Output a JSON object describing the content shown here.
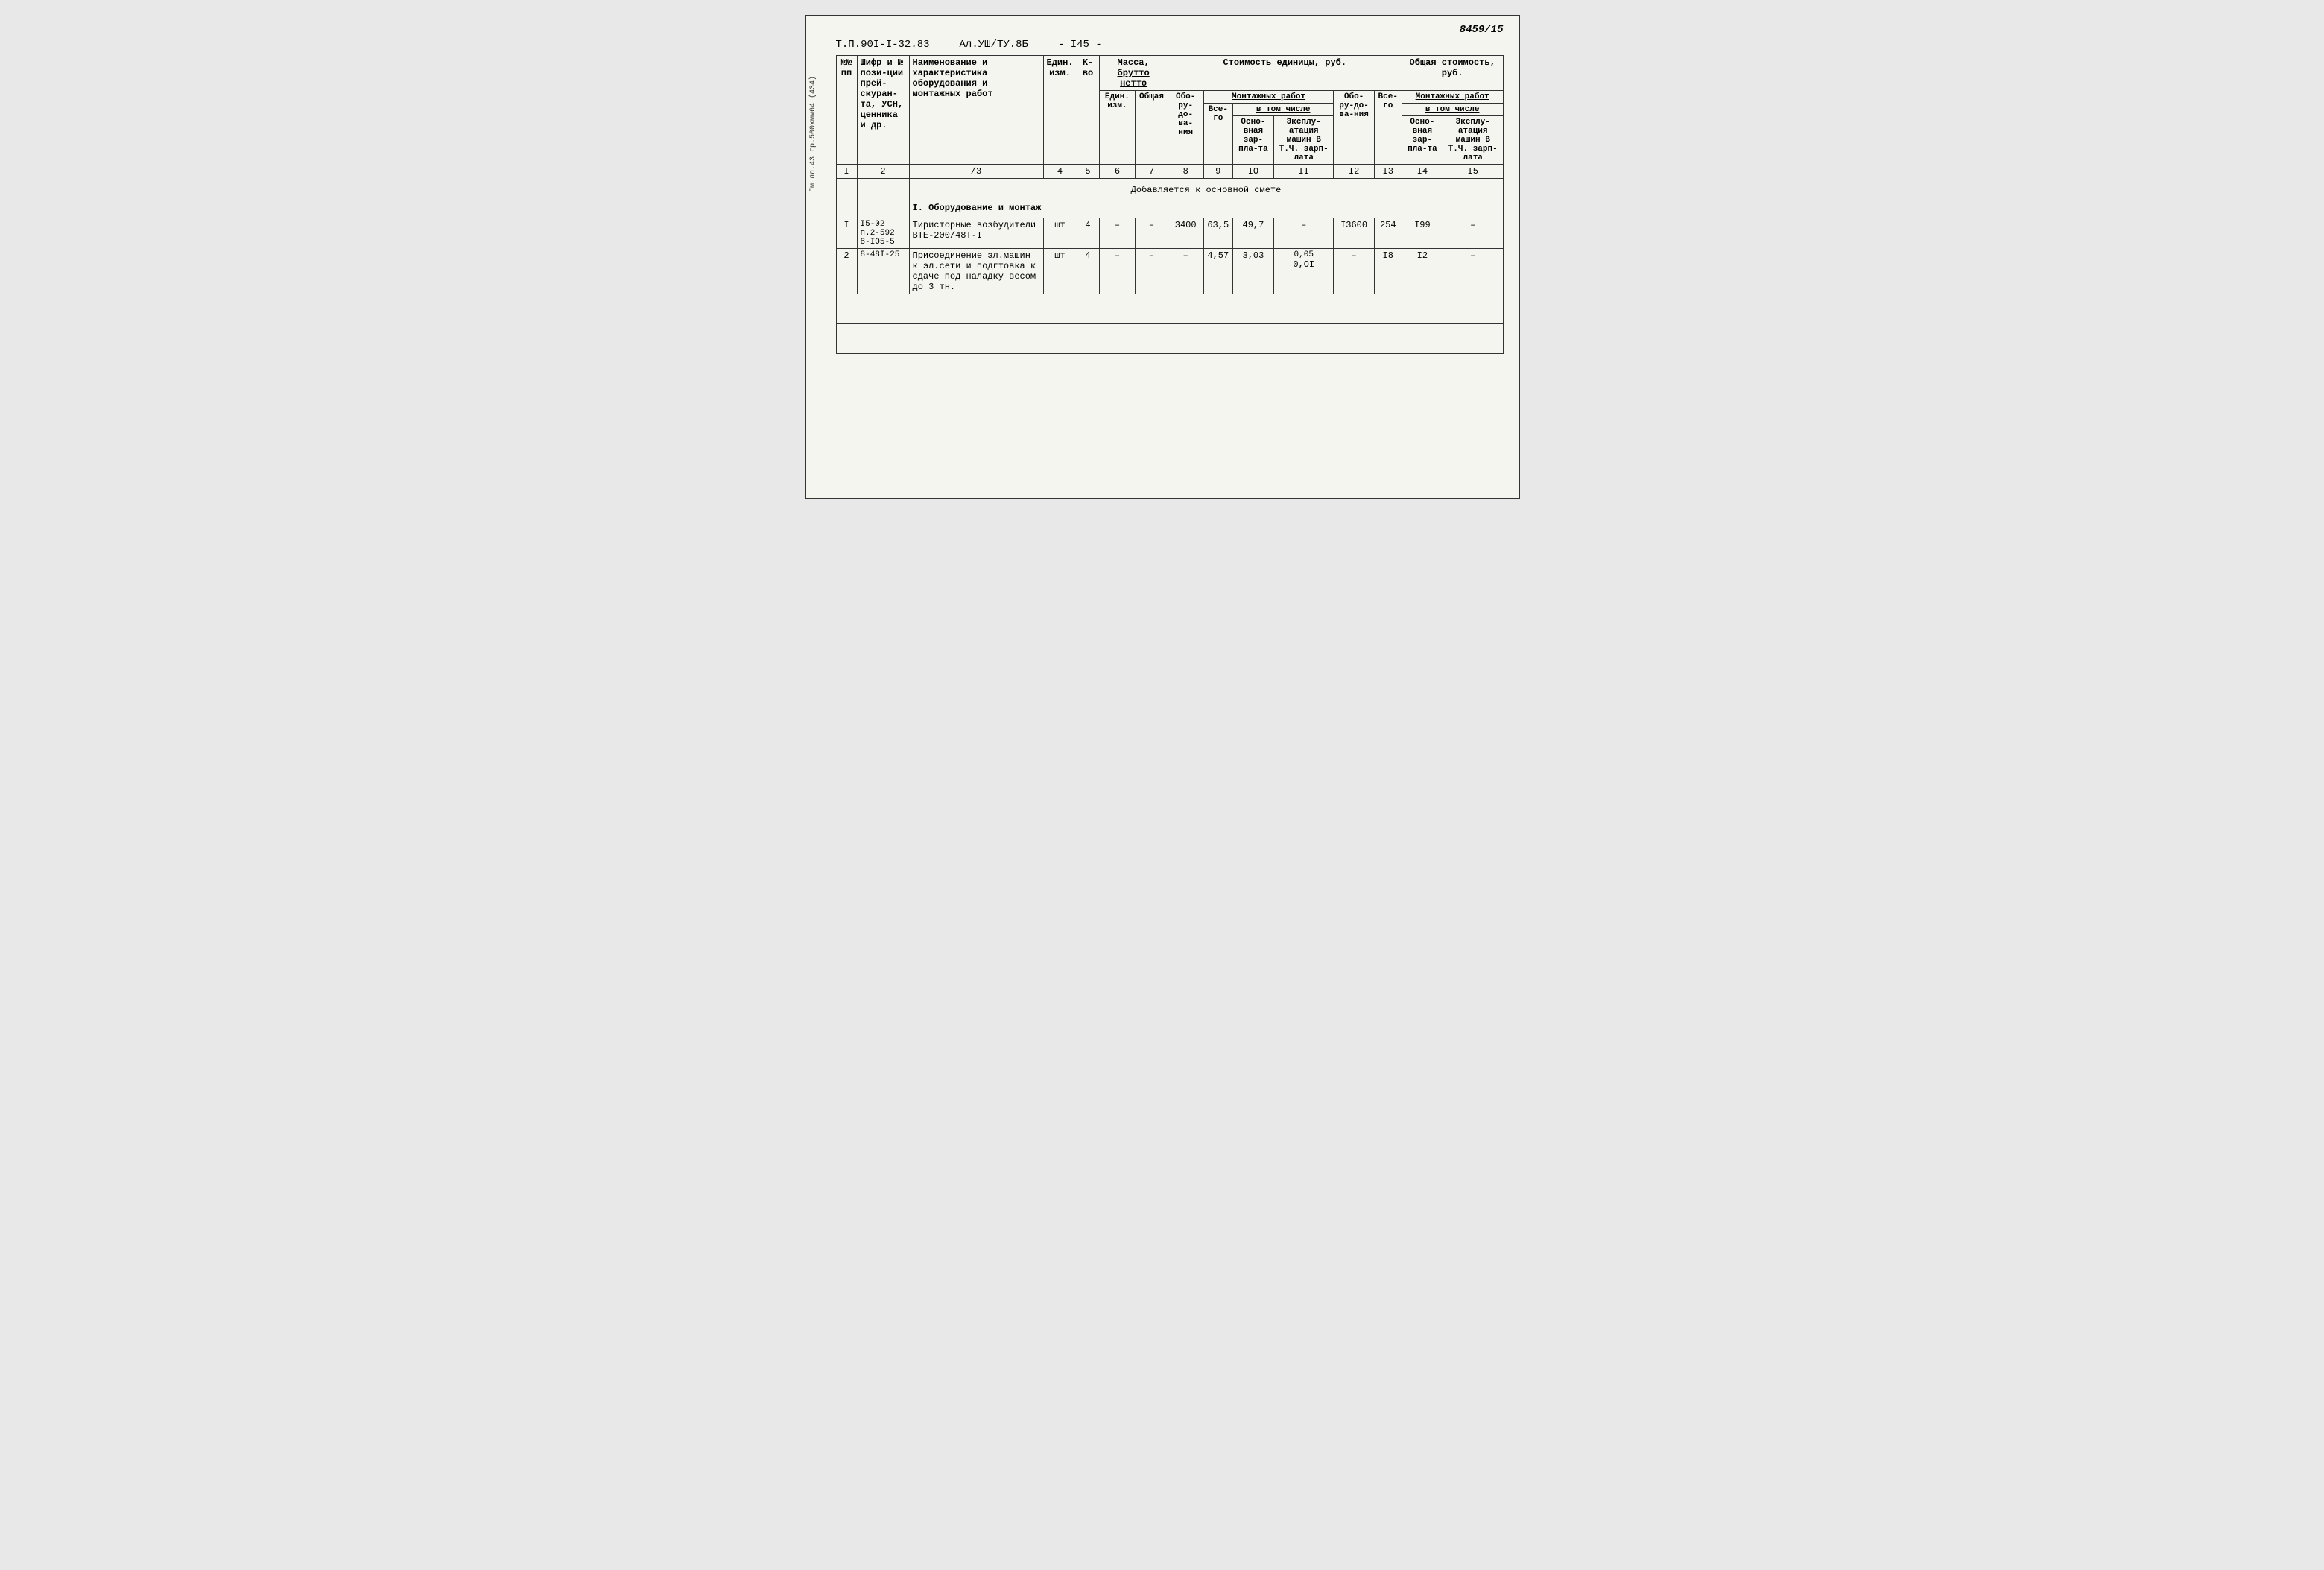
{
  "page": {
    "doc_number": "8459/15",
    "side_text": "Гм лл.43 гр.500хмм64 (434)",
    "header": {
      "code1": "Т.П.90I-I-32.83",
      "code2": "Ал.УШ/ТУ.8Б",
      "code3": "- I45 -"
    },
    "col_headers": {
      "col1": "№№ пп",
      "col2": "Шифр и № пози-ции прей-скуран-та, УСН, ценника и др.",
      "col3": "Наименование и характеристика оборудования и монтажных работ",
      "col4": "Един. изм.",
      "col5": "К-во",
      "col6_label": "Масса, брутто нетто",
      "col6a": "Един. изм.",
      "col6b": "Общая",
      "col7_label": "Стоимость единицы, руб.",
      "col8": "Обо-ру-до-ва-ния",
      "col9": "Все-го",
      "col10_label": "Монтажных работ",
      "col10a_label": "в том числе",
      "col10a": "Осно-вная зар-пла-та",
      "col10b": "Эксплу-атация машин В Т.Ч. зарп-лата",
      "col11": "Обо-ру-до-ва-ния",
      "col12_label": "Общая стоимость, руб.",
      "col12": "Все-го",
      "col13_label": "Монтажных работ",
      "col13a_label": "в том числе",
      "col13a": "Осно-вная зар-пла-та",
      "col13b": "Эксплу-атация машин В Т.Ч. зарп-лата"
    },
    "row_numbers": {
      "r1": "I",
      "r2": "2",
      "r3": "/3",
      "r4": "4",
      "r5": "5",
      "r6": "6",
      "r7": "7",
      "r8": "8",
      "r9": "9",
      "r10": "IO",
      "r11": "II",
      "r12": "I2",
      "r13": "I3",
      "r14": "I4",
      "r15": "I5"
    },
    "section_header": "Добавляется к основной смете",
    "section_title": "I. Оборудование и монтаж",
    "rows": [
      {
        "num": "I",
        "code": "I5-02\nп.2-592\n8-IO5-5",
        "name": "Тиристорные возбудители ВТЕ-200/48Т-I",
        "unit": "шт",
        "qty": "4",
        "mass_unit": "–",
        "mass_total": "–",
        "equip_cost": "3400",
        "total_cost": "63,5",
        "labor_main": "49,7",
        "labor_exp": "–",
        "equip_total": "I3600",
        "grand_total": "254",
        "labor_main_total": "I99",
        "labor_exp_total": "–"
      },
      {
        "num": "2",
        "code": "8-48I-25",
        "name": "Присоединение эл.машин к эл.сети и подгтовка к сдаче под наладку весом до 3 тн.",
        "unit": "шт",
        "qty": "4",
        "mass_unit": "–",
        "mass_total": "–",
        "equip_cost": "–",
        "total_cost": "4,57",
        "labor_main": "3,03",
        "labor_exp_top": "0,05",
        "labor_exp": "0,OI",
        "equip_total": "–",
        "grand_total": "I8",
        "labor_main_total": "I2",
        "labor_exp_total": "–"
      }
    ]
  }
}
